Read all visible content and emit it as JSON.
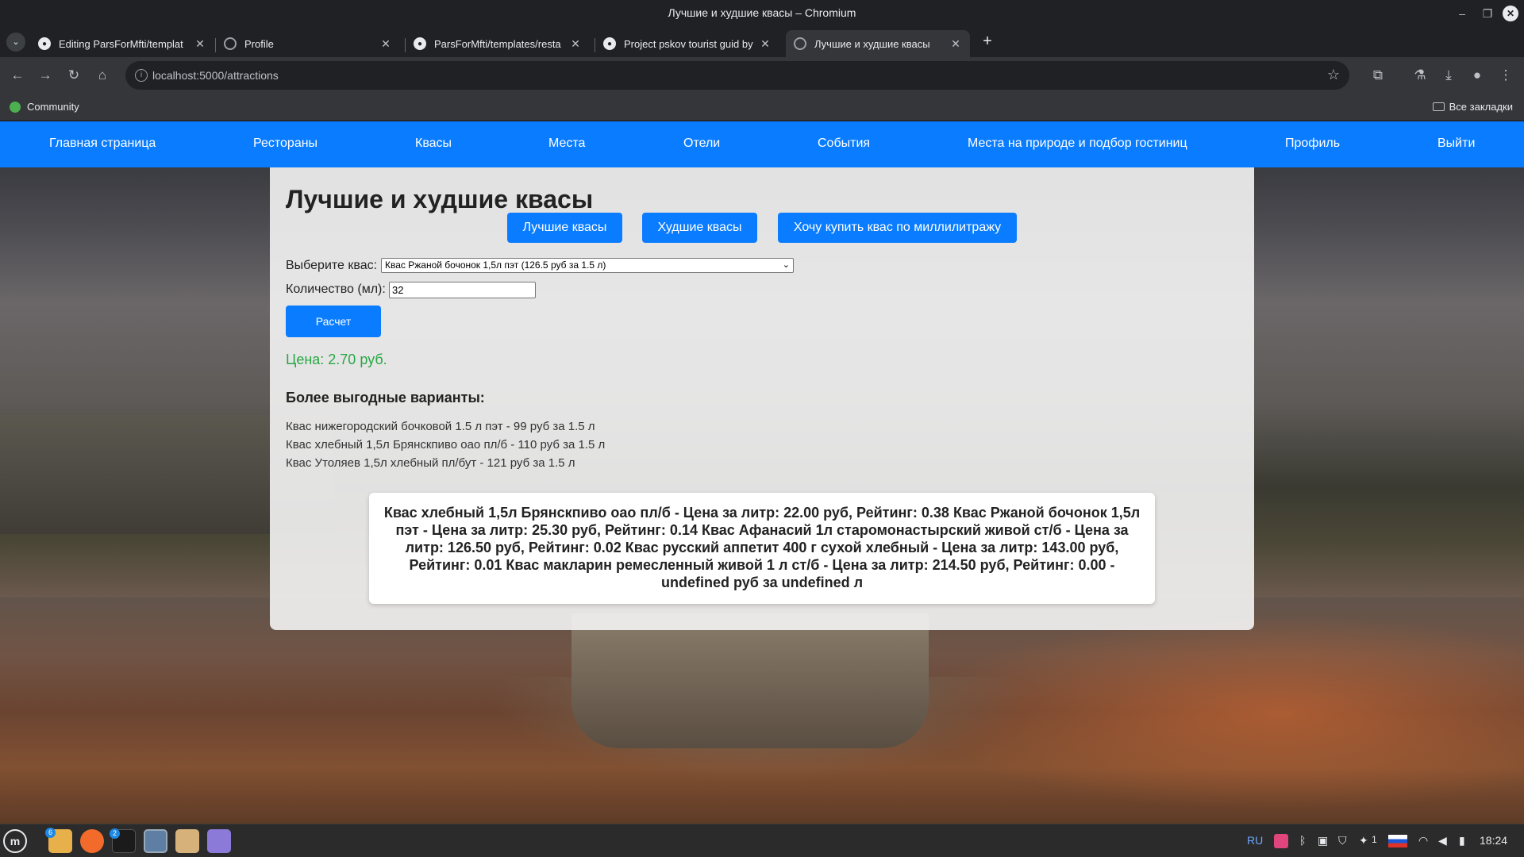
{
  "window": {
    "title": "Лучшие и худшие квасы – Chromium"
  },
  "tabs": [
    {
      "label": "Editing ParsForMfti/templat",
      "icon": "github-icon"
    },
    {
      "label": "Profile",
      "icon": "globe-icon"
    },
    {
      "label": "ParsForMfti/templates/resta",
      "icon": "github-icon"
    },
    {
      "label": "Project pskov tourist guid by",
      "icon": "github-icon"
    },
    {
      "label": "Лучшие и худшие квасы",
      "icon": "globe-icon",
      "active": true
    }
  ],
  "address_bar": {
    "url": "localhost:5000/attractions"
  },
  "bookmarks": {
    "item": "Community",
    "all": "Все закладки"
  },
  "nav": {
    "items": [
      "Главная страница",
      "Рестораны",
      "Квасы",
      "Места",
      "Отели",
      "События",
      "Места на природе и подбор гостиниц",
      "Профиль",
      "Выйти"
    ]
  },
  "page": {
    "title": "Лучшие и худшие квасы",
    "buttons": {
      "best": "Лучшие квасы",
      "worst": "Худшие квасы",
      "by_volume": "Хочу купить квас по миллилитражу"
    },
    "select_label": "Выберите квас:",
    "select_value": "Квас Ржаной бочонок 1,5л пэт (126.5 руб за 1.5 л)",
    "qty_label": "Количество (мл):",
    "qty_value": "32",
    "calc_button": "Расчет",
    "price": "Цена: 2.70 руб.",
    "alternatives_heading": "Более выгодные варианты:",
    "alternatives": [
      "Квас нижегородский бочковой 1.5 л пэт - 99 руб за 1.5 л",
      "Квас хлебный 1,5л Брянскпиво оао пл/б - 110 руб за 1.5 л",
      "Квас Утоляев 1,5л хлебный пл/бут - 121 руб за 1.5 л"
    ],
    "ratings_text": "Квас хлебный 1,5л Брянскпиво оао пл/б - Цена за литр: 22.00 руб, Рейтинг: 0.38 Квас Ржаной бочонок 1,5л пэт - Цена за литр: 25.30 руб, Рейтинг: 0.14 Квас Афанасий 1л старомонастырский живой ст/б - Цена за литр: 126.50 руб, Рейтинг: 0.02 Квас русский аппетит 400 г сухой хлебный - Цена за литр: 143.00 руб, Рейтинг: 0.01 Квас макларин ремесленный живой 1 л ст/б - Цена за литр: 214.50 руб, Рейтинг: 0.00 - undefined руб за undefined л"
  },
  "taskbar": {
    "lang": "RU",
    "time": "18:24",
    "badges": {
      "files": "6",
      "terminal": "2"
    },
    "notif_count": "1"
  },
  "colors": {
    "nav": "#0a7cff",
    "accent": "#0a7cff",
    "price": "#28a745"
  }
}
